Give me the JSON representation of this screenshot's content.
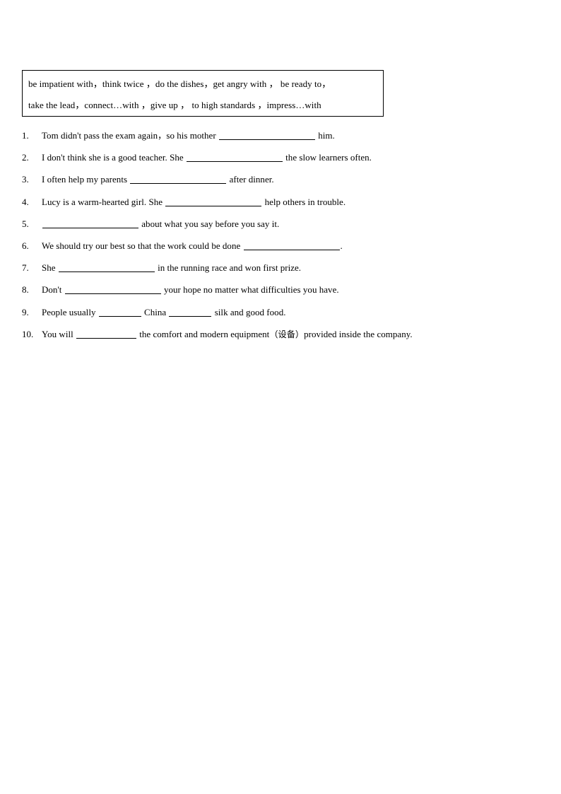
{
  "document": {
    "type": "worksheet",
    "background_color": "#ffffff",
    "text_color": "#000000"
  },
  "word_bank": {
    "border_color": "#000000",
    "lines": [
      "be impatient with，think twice ，do the dishes，get angry with ，  be ready to，",
      "take the lead，connect…with ，give up ，   to high standards ，impress…with"
    ],
    "terms": [
      "be impatient with",
      "think twice",
      "do the dishes",
      "get angry with",
      "be ready to",
      "take the lead",
      "connect…with",
      "give up",
      "to high standards",
      "impress…with"
    ]
  },
  "questions": [
    {
      "number": "1.",
      "before": "Tom didn't pass the exam again，so his mother ",
      "blank": "std",
      "after": " him.",
      "blank2": null,
      "after2": ""
    },
    {
      "number": "2.",
      "before": "I don't think she is a good teacher. She ",
      "blank": "std",
      "after": " the slow learners often.",
      "blank2": null,
      "after2": ""
    },
    {
      "number": "3.",
      "before": "I often help my parents ",
      "blank": "std",
      "after": " after dinner.",
      "blank2": null,
      "after2": ""
    },
    {
      "number": "4.",
      "before": "Lucy is a warm-hearted girl. She ",
      "blank": "std",
      "after": " help others in trouble.",
      "blank2": null,
      "after2": ""
    },
    {
      "number": "5.",
      "before": "",
      "blank": "std",
      "after": " about what you say before you say it.",
      "blank2": null,
      "after2": ""
    },
    {
      "number": "6.",
      "before": "We should try our best so that the work could be done ",
      "blank": "std",
      "after": ".",
      "blank2": null,
      "after2": ""
    },
    {
      "number": "7.",
      "before": "She ",
      "blank": "std",
      "after": " in the running race and won first prize.",
      "blank2": null,
      "after2": ""
    },
    {
      "number": "8.",
      "before": "Don't ",
      "blank": "std",
      "after": " your hope no matter what difficulties you have.",
      "blank2": null,
      "after2": ""
    },
    {
      "number": "9.",
      "before": "People usually ",
      "blank": "short",
      "after": " China ",
      "blank2": "short",
      "after2": " silk and good food."
    },
    {
      "number": "10.",
      "before": "You will ",
      "blank": "mid",
      "after": " the comfort and modern equipment（设备）provided inside the company.",
      "blank2": null,
      "after2": ""
    }
  ]
}
